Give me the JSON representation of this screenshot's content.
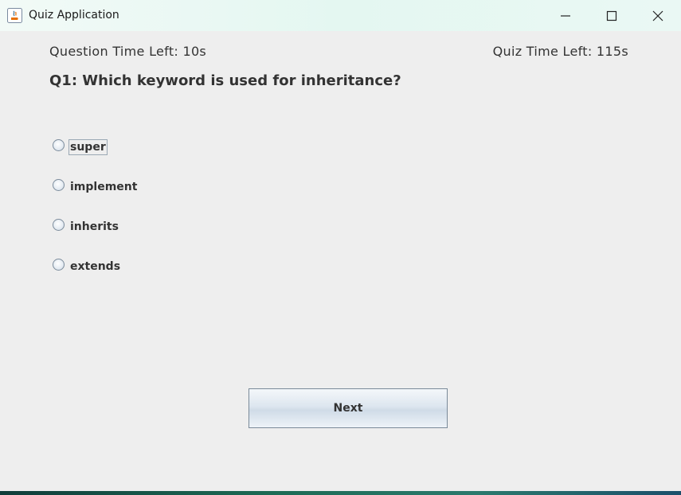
{
  "window": {
    "title": "Quiz Application",
    "icon": "java-icon"
  },
  "controls": {
    "minimize_icon": "minimize-icon",
    "maximize_icon": "maximize-icon",
    "close_icon": "close-icon"
  },
  "timers": {
    "question_time": "Question Time Left: 10s",
    "quiz_time": "Quiz Time Left: 115s"
  },
  "question": {
    "text": "Q1: Which keyword is used for inheritance?",
    "options": [
      {
        "label": "super",
        "selected": false,
        "focused": true
      },
      {
        "label": "implement",
        "selected": false,
        "focused": false
      },
      {
        "label": "inherits",
        "selected": false,
        "focused": false
      },
      {
        "label": "extends",
        "selected": false,
        "focused": false
      }
    ]
  },
  "actions": {
    "next_label": "Next"
  },
  "colors": {
    "window_bg": "#eeeeee",
    "text": "#333333",
    "titlebar": "#e4f7f1"
  }
}
